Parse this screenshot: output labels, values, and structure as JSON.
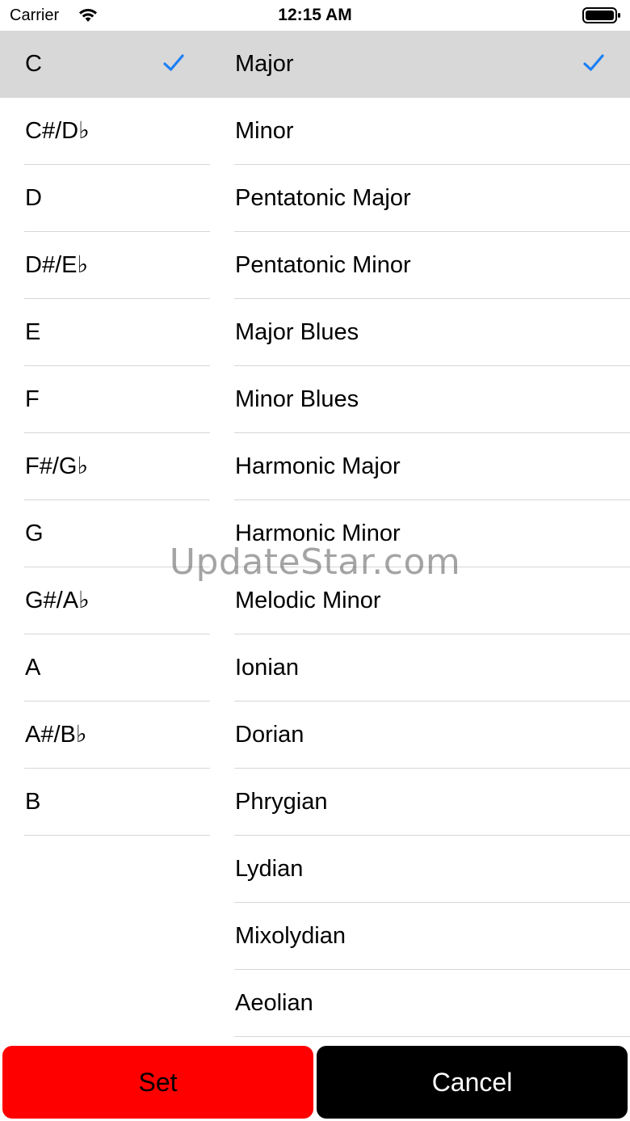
{
  "status_bar": {
    "carrier": "Carrier",
    "time": "12:15 AM"
  },
  "keys": {
    "selected_index": 0,
    "items": [
      "C",
      "C#/D♭",
      "D",
      "D#/E♭",
      "E",
      "F",
      "F#/G♭",
      "G",
      "G#/A♭",
      "A",
      "A#/B♭",
      "B"
    ]
  },
  "scales": {
    "selected_index": 0,
    "items": [
      "Major",
      "Minor",
      "Pentatonic Major",
      "Pentatonic Minor",
      "Major Blues",
      "Minor Blues",
      "Harmonic Major",
      "Harmonic Minor",
      "Melodic Minor",
      "Ionian",
      "Dorian",
      "Phrygian",
      "Lydian",
      "Mixolydian",
      "Aeolian"
    ]
  },
  "buttons": {
    "set_label": "Set",
    "cancel_label": "Cancel"
  },
  "watermark": "UpdateStar.com",
  "colors": {
    "checkmark": "#1a7ff5",
    "selected_row": "#d8d8d8",
    "set_button": "#ff0000",
    "cancel_button": "#000000"
  }
}
